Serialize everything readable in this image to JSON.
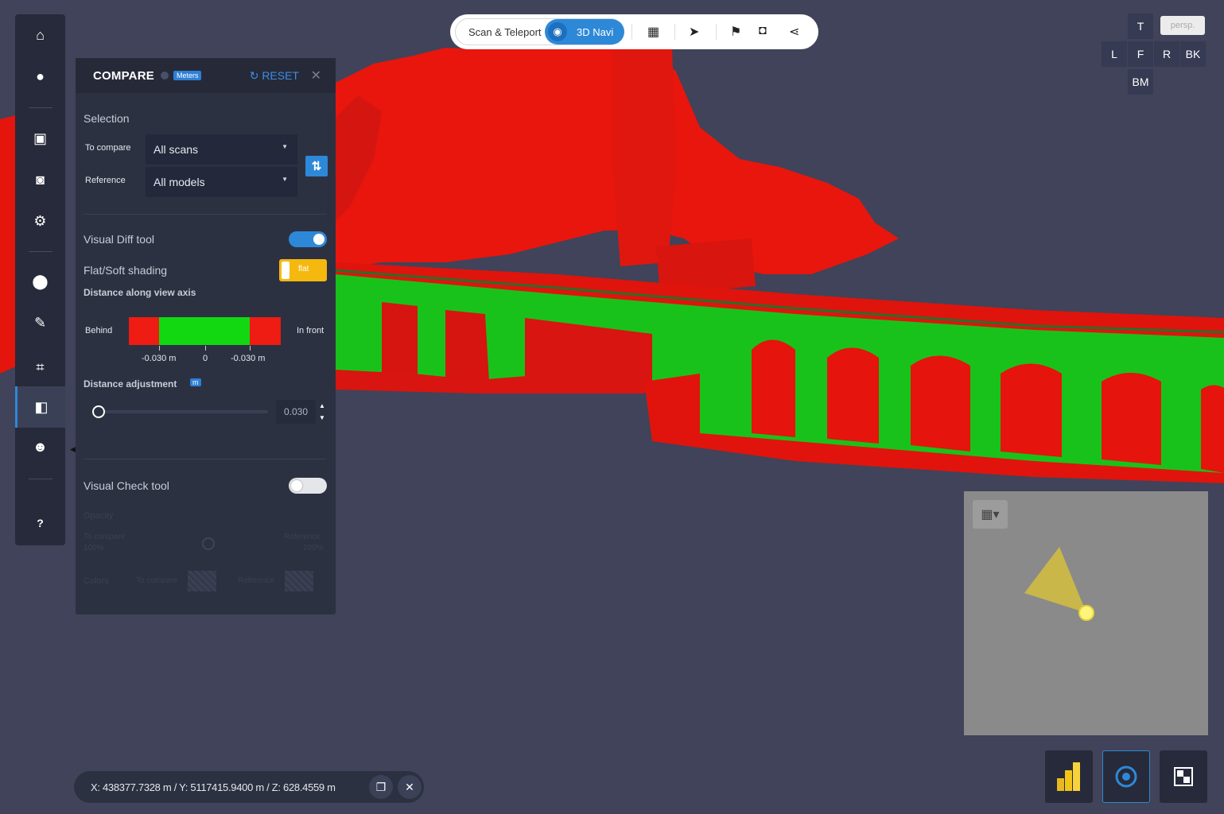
{
  "sidebar": {
    "items": [
      {
        "name": "home-icon",
        "glyph": "⌂"
      },
      {
        "name": "record-icon",
        "glyph": "●"
      },
      {
        "name": "screen-icon",
        "glyph": "▣"
      },
      {
        "name": "camera-icon",
        "glyph": "◙"
      },
      {
        "name": "gear-icon",
        "glyph": "⚙"
      },
      {
        "name": "pin-icon",
        "glyph": "⬤"
      },
      {
        "name": "ruler-icon",
        "glyph": "✎"
      },
      {
        "name": "crop-icon",
        "glyph": "⌗"
      },
      {
        "name": "compare-icon",
        "glyph": "◧"
      },
      {
        "name": "user-icon",
        "glyph": "☻"
      },
      {
        "name": "help-icon",
        "glyph": "?"
      }
    ]
  },
  "panel": {
    "title": "COMPARE",
    "unit_badge": "Meters",
    "reset_label": "RESET",
    "close_glyph": "✕",
    "selection_label": "Selection",
    "to_compare_label": "To compare",
    "to_compare_value": "All scans",
    "reference_label": "Reference",
    "reference_value": "All models",
    "visual_diff_label": "Visual Diff tool",
    "visual_diff_on": true,
    "shading_label": "Flat/Soft shading",
    "shading_value": "flat",
    "distance_axis_label": "Distance along view axis",
    "behind_label": "Behind",
    "in_front_label": "In front",
    "tick_labels": [
      "-0.030 m",
      "0",
      "-0.030 m"
    ],
    "distance_adjust_label": "Distance adjustment",
    "distance_adjust_badge": "m",
    "distance_value": "0.030",
    "slider_fraction": 0.0,
    "visual_check_label": "Visual Check tool",
    "visual_check_on": false,
    "opacity_label": "Opacity",
    "opacity_left": "To compare",
    "opacity_left_pct": "100%",
    "opacity_right": "Reference",
    "opacity_right_pct": "100%",
    "colors_label": "Colors",
    "colors_to_compare": "To compare",
    "colors_reference": "Reference",
    "colors": {
      "red": "#ee1c12",
      "green": "#12d812",
      "accent": "#2e88d8"
    }
  },
  "toolbar": {
    "scan_teleport": "Scan & Teleport",
    "nav_3d": "3D Navi",
    "icons": [
      "grid-icon",
      "pointer-icon",
      "flag-icon",
      "camera-icon",
      "share-icon"
    ]
  },
  "viewcube": {
    "top": "T",
    "left": "L",
    "front": "F",
    "right": "R",
    "back": "BK",
    "bottom": "BM",
    "persp": "persp."
  },
  "coords": {
    "text": "X: 438377.7328 m / Y: 5117415.9400 m / Z: 628.4559 m"
  }
}
